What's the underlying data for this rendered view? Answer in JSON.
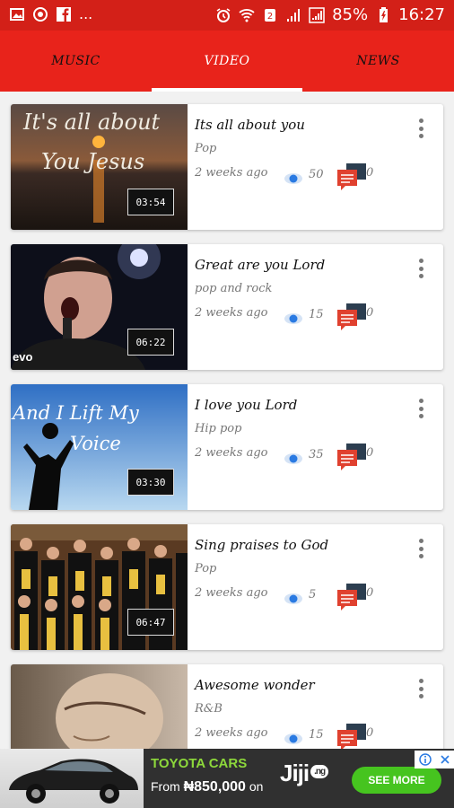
{
  "status": {
    "more_notifications": "...",
    "battery": "85%",
    "time": "16:27"
  },
  "tabs": [
    {
      "label": "MUSIC"
    },
    {
      "label": "VIDEO"
    },
    {
      "label": "NEWS"
    }
  ],
  "videos": [
    {
      "title": "Its all about you",
      "genre": "Pop",
      "age": "2 weeks ago",
      "views": "50",
      "comments": "0",
      "duration": "03:54",
      "thumb_text": [
        "It's all about",
        "You Jesus"
      ]
    },
    {
      "title": "Great are you Lord",
      "genre": "pop and rock",
      "age": "2 weeks ago",
      "views": "15",
      "comments": "0",
      "duration": "06:22",
      "thumb_text": [
        "evo"
      ]
    },
    {
      "title": "I love you Lord",
      "genre": "Hip pop",
      "age": "2 weeks ago",
      "views": "35",
      "comments": "0",
      "duration": "03:30",
      "thumb_text": [
        "And I Lift My",
        "Voice"
      ]
    },
    {
      "title": "Sing praises to God",
      "genre": "Pop",
      "age": "2 weeks ago",
      "views": "5",
      "comments": "0",
      "duration": "06:47",
      "thumb_text": []
    },
    {
      "title": "Awesome wonder",
      "genre": "R&B",
      "age": "2 weeks ago",
      "views": "15",
      "comments": "0",
      "duration": "",
      "thumb_text": []
    }
  ],
  "ad": {
    "title": "TOYOTA CARS",
    "price_prefix": "From",
    "price": "₦850,000",
    "price_suffix": "on",
    "brand": "Jiji",
    "brand_tld": ".ng",
    "cta": "SEE MORE"
  },
  "colors": {
    "toolbar": "#e8231b",
    "statusbar": "#d32018",
    "views_icon": "#2a7ae2",
    "comment_icon_front": "#e0412f",
    "comment_icon_back": "#2c3e50",
    "ad_cta": "#46c41f"
  }
}
